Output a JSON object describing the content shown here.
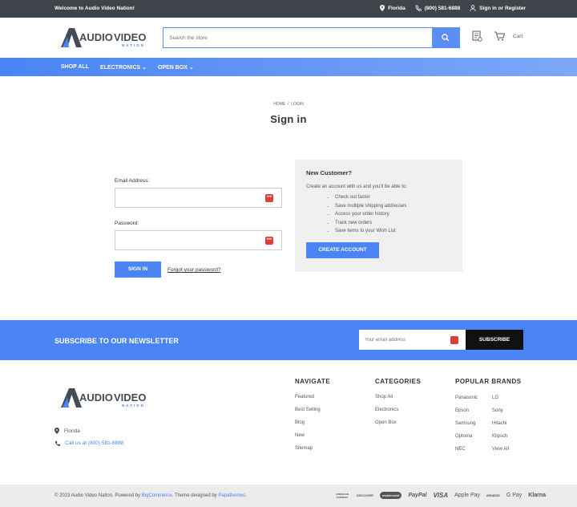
{
  "topbar": {
    "welcome": "Welcome to Audio Video Nation!",
    "location": "Florida",
    "phone": "(800) 581-6888",
    "account": "Sign in or Register"
  },
  "header": {
    "logo_left": "AUDIO",
    "logo_right": "VIDEO",
    "logo_sub": "NATION",
    "search_placeholder": "Search the store",
    "cart_label": "Cart"
  },
  "nav": {
    "items": [
      {
        "label": "SHOP ALL"
      },
      {
        "label": "ELECTRONICS"
      },
      {
        "label": "OPEN BOX"
      }
    ]
  },
  "breadcrumb": {
    "home": "HOME",
    "sep": "/",
    "current": "LOGIN"
  },
  "page": {
    "title": "Sign in"
  },
  "login_form": {
    "email_label": "Email Address:",
    "email_value": "",
    "password_label": "Password:",
    "password_value": "",
    "signin_label": "SIGN IN",
    "forgot_label": "Forgot your password?"
  },
  "new_customer": {
    "title": "New Customer?",
    "intro": "Create an account with us and you'll be able to:",
    "benefits": [
      "Check out faster",
      "Save multiple shipping addresses",
      "Access your order history",
      "Track new orders",
      "Save items to your Wish List"
    ],
    "create_label": "CREATE ACCOUNT"
  },
  "newsletter": {
    "heading": "SUBSCRIBE TO OUR NEWSLETTER",
    "placeholder": "Your email address",
    "button": "SUBSCRIBE"
  },
  "footer": {
    "location": "Florida",
    "phone_text": "Call us at (800) 581-6888",
    "navigate": {
      "title": "NAVIGATE",
      "links": [
        "Featured",
        "Best Selling",
        "Blog",
        "New",
        "Sitemap"
      ]
    },
    "categories": {
      "title": "CATEGORIES",
      "links": [
        "Shop All",
        "Electronics",
        "Open Box"
      ]
    },
    "brands": {
      "title": "POPULAR BRANDS",
      "col1": [
        "Panasonic",
        "Epson",
        "Samsung",
        "Optoma",
        "NEC"
      ],
      "col2": [
        "LG",
        "Sony",
        "Hitachi",
        "Klipsch",
        "View All"
      ]
    }
  },
  "bottombar": {
    "copy_a": "© 2023 Audio Video Nation. Powered by ",
    "copy_link1": "BigCommerce",
    "copy_b": ". Theme designed by ",
    "copy_link2": "Papathemes",
    "copy_c": ".",
    "payments": [
      "AMERICAN EXPRESS",
      "DISCOVER",
      "mastercard",
      "PayPal",
      "VISA",
      "Apple Pay",
      "amazon",
      "G Pay",
      "Klarna"
    ]
  },
  "colors": {
    "accent": "#4a84f5",
    "topbar": "#3f444b",
    "dark": "#111111"
  }
}
